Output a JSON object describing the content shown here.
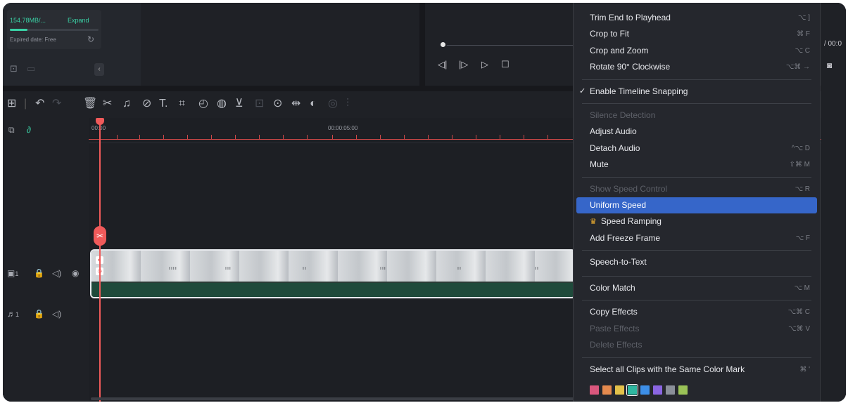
{
  "storage": {
    "used": "154.78MB/...",
    "expand_label": "Expand",
    "usage_fraction": 0.2,
    "expired": "Expired date: Free"
  },
  "preview": {
    "timecode": "/ 00:0"
  },
  "timeline": {
    "ruler_labels": [
      "00:00",
      "00:00:05:00"
    ],
    "video_track_label": "1",
    "audio_track_label": "1"
  },
  "context_menu": {
    "items": [
      {
        "label": "Trim End to Playhead",
        "shortcut": "⌥ ]"
      },
      {
        "label": "Crop to Fit",
        "shortcut": "⌘ F"
      },
      {
        "label": "Crop and Zoom",
        "shortcut": "⌥ C"
      },
      {
        "label": "Rotate 90° Clockwise",
        "shortcut": "⌥⌘ →"
      },
      {
        "label": "Enable Timeline Snapping",
        "checked": true
      },
      {
        "label": "Silence Detection",
        "disabled": true
      },
      {
        "label": "Adjust Audio"
      },
      {
        "label": "Detach Audio",
        "shortcut": "^⌥ D"
      },
      {
        "label": "Mute",
        "shortcut": "⇧⌘ M"
      },
      {
        "label": "Show Speed Control",
        "shortcut": "⌥ R",
        "disabled": true
      },
      {
        "label": "Uniform Speed",
        "selected": true
      },
      {
        "label": "Speed Ramping"
      },
      {
        "label": "Add Freeze Frame",
        "shortcut": "⌥ F"
      },
      {
        "label": "Speech-to-Text"
      },
      {
        "label": "Color Match",
        "shortcut": "⌥ M"
      },
      {
        "label": "Copy Effects",
        "shortcut": "⌥⌘ C"
      },
      {
        "label": "Paste Effects",
        "shortcut": "⌥⌘ V",
        "disabled": true
      },
      {
        "label": "Delete Effects",
        "disabled": true
      },
      {
        "label": "Select all Clips with the Same Color Mark",
        "shortcut": "⌘ '"
      }
    ],
    "color_marks": [
      "#d9577d",
      "#e58a4e",
      "#e2c14a",
      "#2fb7a0",
      "#3d8fe8",
      "#8b66e2",
      "#8a8f99",
      "#9ac257"
    ]
  },
  "colors": {
    "accent": "#3ad2a6",
    "playhead": "#f05a5a",
    "menu_highlight": "#3666c9"
  }
}
